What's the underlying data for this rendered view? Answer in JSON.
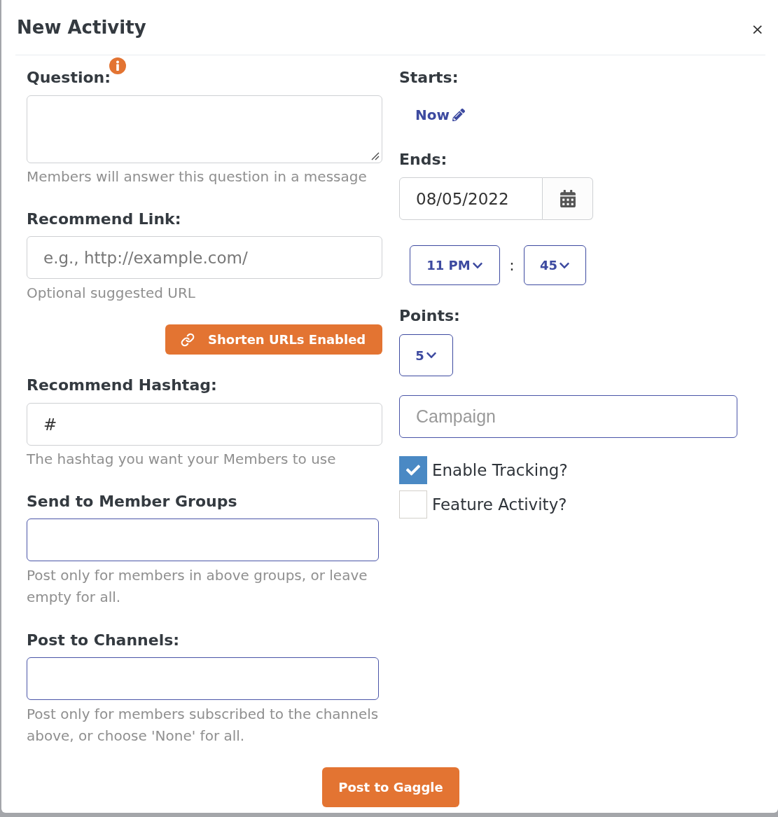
{
  "dialog": {
    "title": "New Activity",
    "close": "×"
  },
  "question": {
    "label": "Question:",
    "help": "Members will answer this question in a message"
  },
  "recommend_link": {
    "label": "Recommend Link:",
    "placeholder": "e.g., http://example.com/",
    "help": "Optional suggested URL"
  },
  "shorten_button": {
    "label": "Shorten URLs Enabled"
  },
  "recommend_hashtag": {
    "label": "Recommend Hashtag:",
    "value": "#",
    "help": "The hashtag you want your Members to use"
  },
  "member_groups": {
    "label": "Send to Member Groups",
    "help": "Post only for members in above groups, or leave empty for all."
  },
  "channels": {
    "label": "Post to Channels:",
    "help": "Post only for members subscribed to the channels above, or choose 'None' for all."
  },
  "starts": {
    "label": "Starts:",
    "value": "Now"
  },
  "ends": {
    "label": "Ends:",
    "date": "08/05/2022",
    "hour": "11 PM",
    "separator": ":",
    "minute": "45"
  },
  "points": {
    "label": "Points:",
    "value": "5"
  },
  "campaign": {
    "placeholder": "Campaign"
  },
  "options": [
    {
      "label": "Enable Tracking?",
      "checked": true
    },
    {
      "label": "Feature Activity?",
      "checked": false
    }
  ],
  "submit": {
    "label": "Post to Gaggle"
  }
}
